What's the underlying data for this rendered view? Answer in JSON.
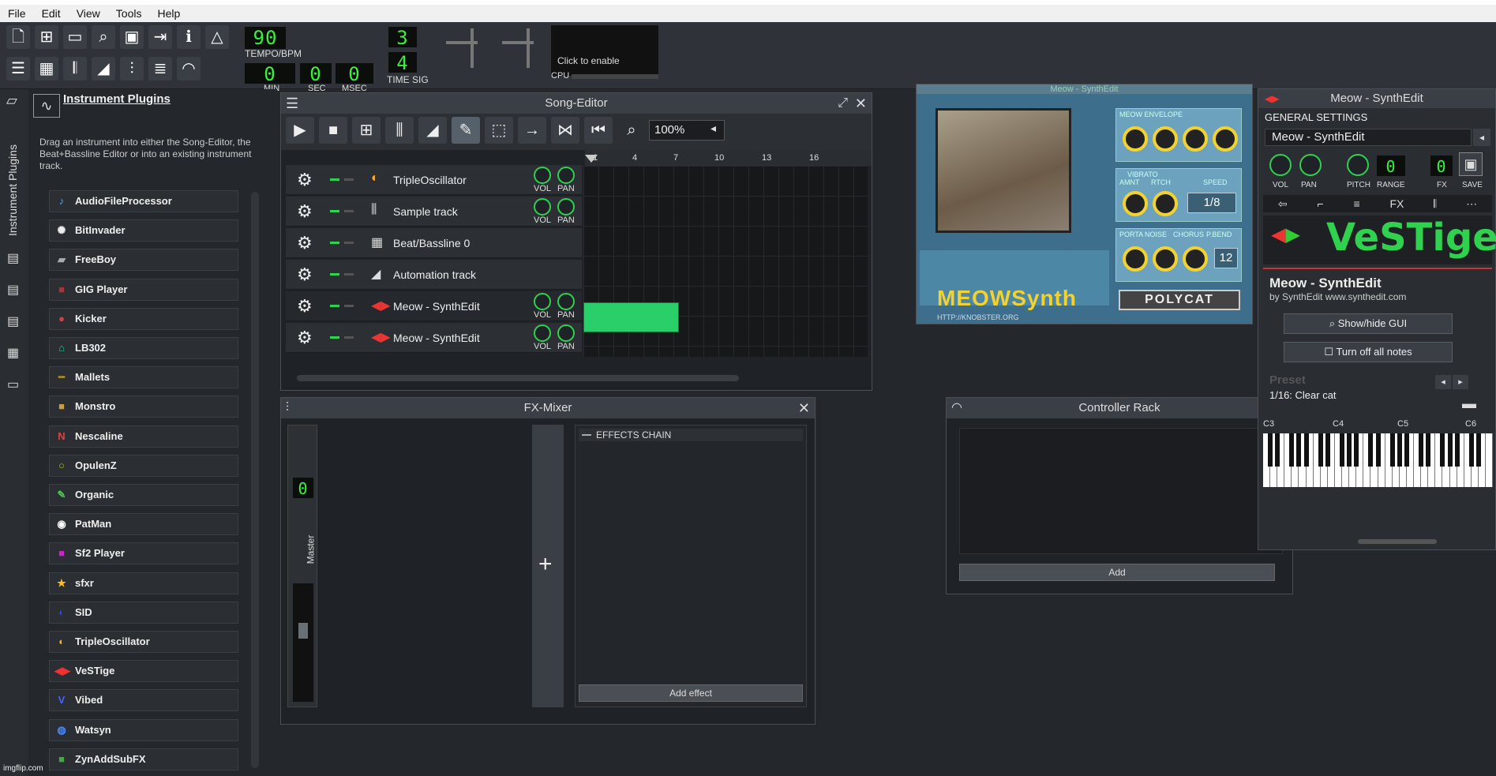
{
  "menu": [
    "File",
    "Edit",
    "View",
    "Tools",
    "Help"
  ],
  "toolbar": {
    "tempo": "90",
    "tempo_label": "TEMPO/BPM",
    "min": "0",
    "min_label": "MIN",
    "sec": "0",
    "sec_label": "SEC",
    "msec": "0",
    "msec_label": "MSEC",
    "timesig_num": "3",
    "timesig_den": "4",
    "timesig_label": "TIME SIG",
    "cpu_text": "Click to enable",
    "cpu_label": "CPU"
  },
  "sidebar": {
    "tab_label": "Instrument Plugins",
    "title": "Instrument Plugins",
    "description": "Drag an instrument into either the Song-Editor, the Beat+Bassline Editor or into an existing instrument track.",
    "items": [
      "AudioFileProcessor",
      "BitInvader",
      "FreeBoy",
      "GIG Player",
      "Kicker",
      "LB302",
      "Mallets",
      "Monstro",
      "Nescaline",
      "OpulenZ",
      "Organic",
      "PatMan",
      "Sf2 Player",
      "sfxr",
      "SID",
      "TripleOscillator",
      "VeSTige",
      "Vibed",
      "Watsyn",
      "ZynAddSubFX"
    ]
  },
  "song_editor": {
    "title": "Song-Editor",
    "zoom": "100%",
    "bars": [
      "1",
      "4",
      "7",
      "10",
      "13",
      "16"
    ],
    "vol": "VOL",
    "pan": "PAN",
    "tracks": [
      "TripleOscillator",
      "Sample track",
      "Beat/Bassline 0",
      "Automation track",
      "Meow - SynthEdit",
      "Meow - SynthEdit"
    ]
  },
  "fx_mixer": {
    "title": "FX-Mixer",
    "level": "0",
    "master_label": "Master",
    "effects_chain": "EFFECTS CHAIN",
    "add_effect": "Add effect"
  },
  "controller_rack": {
    "title": "Controller Rack",
    "add": "Add"
  },
  "meow_plugin": {
    "title": "Meow - SynthEdit",
    "envelope": "MEOW ENVELOPE",
    "vibrato": "VIBRATO",
    "amnt": "AMNT",
    "rtch": "RTCH",
    "speed": "SPEED",
    "speed_value": "1/8",
    "porta": "PORTA",
    "noise": "NOISE",
    "chorus": "CHORUS",
    "pbend": "P.BEND",
    "pbend_value": "12",
    "brand": "MEOWSynth",
    "url": "HTTP://KNOBSTER.ORG",
    "polycat": "POLYCAT"
  },
  "vestige": {
    "title": "Meow - SynthEdit",
    "general": "GENERAL SETTINGS",
    "name": "Meow - SynthEdit",
    "vol": "VOL",
    "pan": "PAN",
    "pitch": "PITCH",
    "range": "RANGE",
    "fx": "FX",
    "save": "SAVE",
    "logo": "VeSTige",
    "plugin_name": "Meow - SynthEdit",
    "plugin_by": "by SynthEdit www.synthedit.com",
    "show_gui": "Show/hide GUI",
    "turn_off": "Turn off all notes",
    "preset_label": "Preset",
    "preset_value": "1/16: Clear cat",
    "keys": [
      "C3",
      "C4",
      "C5",
      "C6"
    ],
    "range_value": "0",
    "fx_value": "0"
  },
  "watermark": "imgflip.com"
}
